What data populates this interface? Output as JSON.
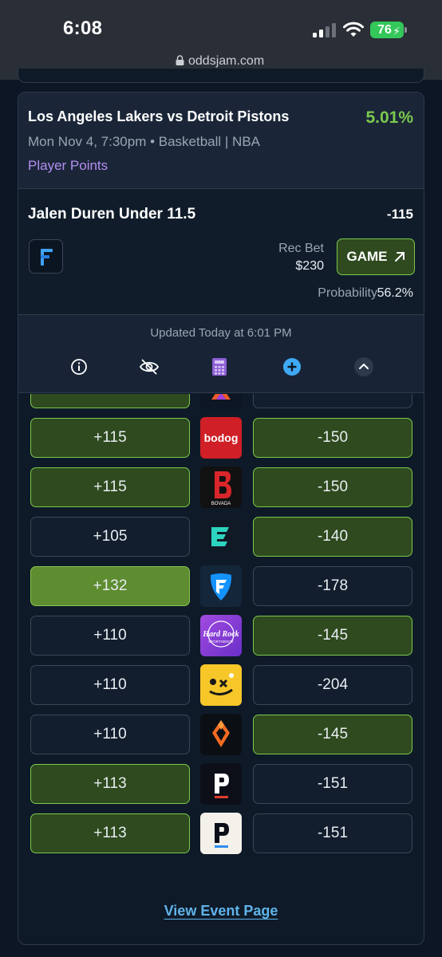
{
  "status_bar": {
    "time": "6:08",
    "battery": "76"
  },
  "browser": {
    "url": "oddsjam.com"
  },
  "card": {
    "match": "Los Angeles Lakers vs Detroit Pistons",
    "edge": "5.01%",
    "meta": "Mon Nov 4, 7:30pm • Basketball | NBA",
    "market": "Player Points",
    "bet_name": "Jalen Duren Under 11.5",
    "bet_odds": "-115",
    "rec_bet_label": "Rec Bet",
    "rec_bet_amount": "$230",
    "game_button": "GAME",
    "probability_label": "Probability",
    "probability_value": "56.2%",
    "updated": "Updated Today at 6:01 PM",
    "tools": [
      "info-icon",
      "hide-icon",
      "calculator-icon",
      "add-icon",
      "collapse-icon"
    ]
  },
  "rows": [
    {
      "over": "",
      "under": "",
      "book": "partial-book",
      "over_style": "good",
      "under_style": "plain"
    },
    {
      "over": "+115",
      "under": "-150",
      "book": "bodog",
      "over_style": "good",
      "under_style": "good"
    },
    {
      "over": "+115",
      "under": "-150",
      "book": "bovada",
      "over_style": "good",
      "under_style": "good"
    },
    {
      "over": "+105",
      "under": "-140",
      "book": "betr",
      "over_style": "plain",
      "under_style": "good"
    },
    {
      "over": "+132",
      "under": "-178",
      "book": "fanduel",
      "over_style": "best",
      "under_style": "plain"
    },
    {
      "over": "+110",
      "under": "-145",
      "book": "hard-rock",
      "over_style": "plain",
      "under_style": "good"
    },
    {
      "over": "+110",
      "under": "-204",
      "book": "sleeper",
      "over_style": "plain",
      "under_style": "plain"
    },
    {
      "over": "+110",
      "under": "-145",
      "book": "draftkings",
      "over_style": "plain",
      "under_style": "good"
    },
    {
      "over": "+113",
      "under": "-151",
      "book": "prizepicks-dark",
      "over_style": "good",
      "under_style": "plain"
    },
    {
      "over": "+113",
      "under": "-151",
      "book": "prizepicks-light",
      "over_style": "good",
      "under_style": "plain"
    }
  ],
  "book_logo_text": {
    "bodog": "bodog",
    "bovada": "BOVADA",
    "hard_rock_top": "Hard Rock",
    "hard_rock_bottom": "SPORTSBOOK"
  },
  "view_event": "View Event Page",
  "colors": {
    "accent_green": "#7cc94e",
    "good_fill": "#2e4a1e",
    "best_fill": "#5e8c30",
    "link_blue": "#5fb4ea",
    "market_purple": "#b48ef0"
  }
}
